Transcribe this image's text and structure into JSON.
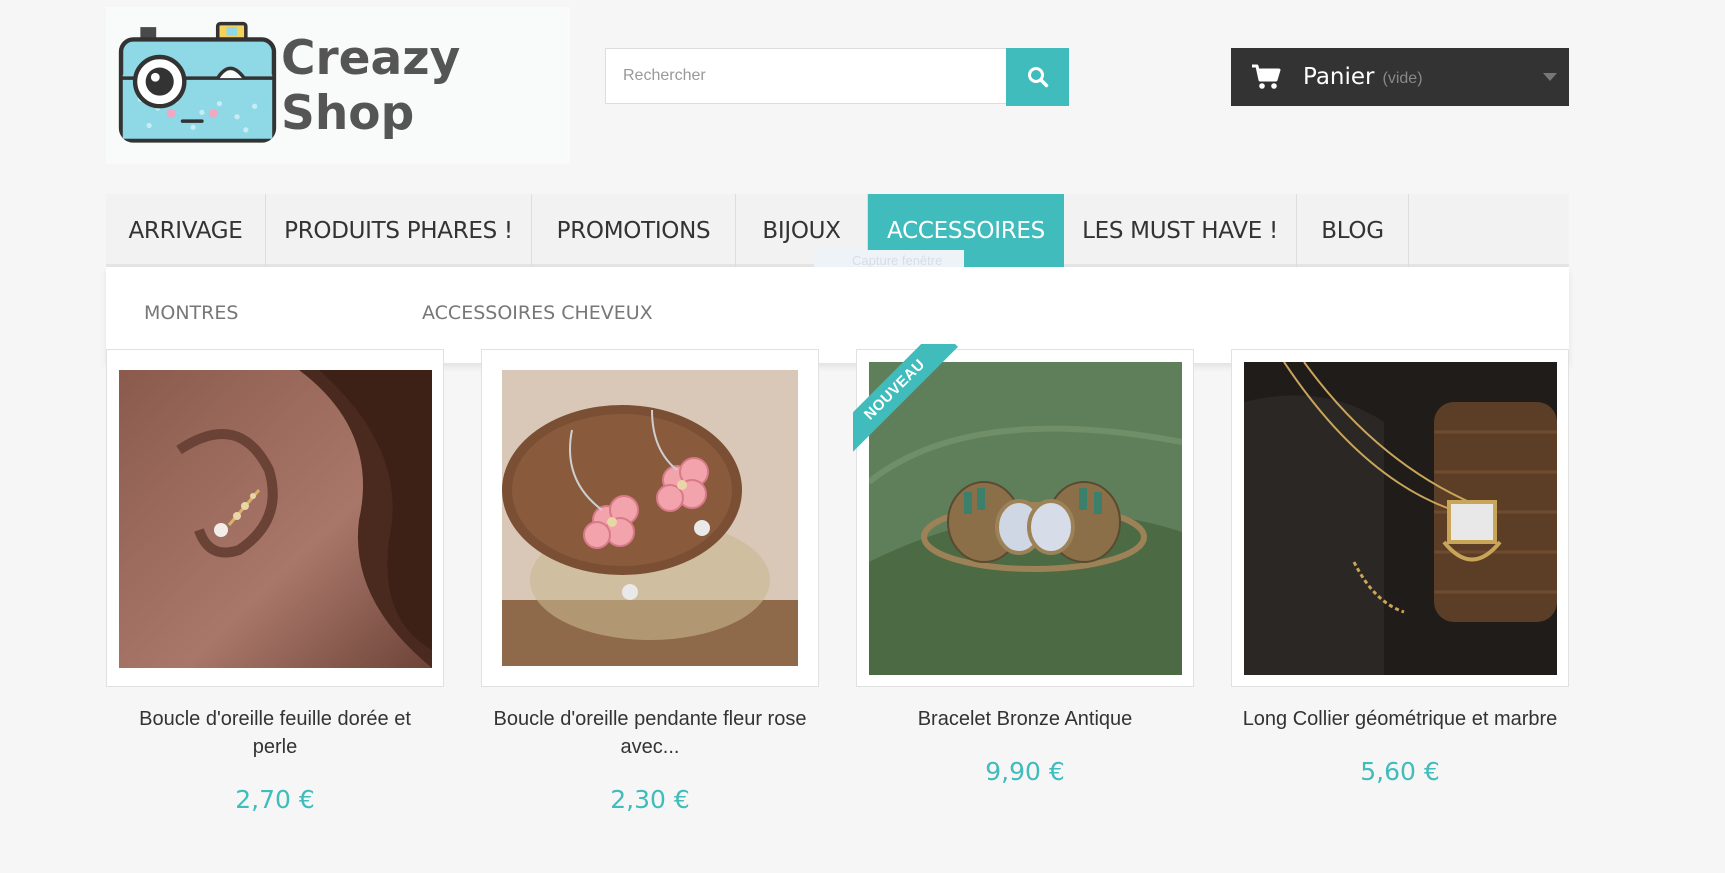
{
  "brand": {
    "name": "Creazy Shop"
  },
  "search": {
    "placeholder": "Rechercher"
  },
  "cart": {
    "label": "Panier",
    "status": "(vide)"
  },
  "menu": {
    "items": [
      {
        "label": "ARRIVAGE"
      },
      {
        "label": "PRODUITS PHARES !"
      },
      {
        "label": "PROMOTIONS"
      },
      {
        "label": "BIJOUX"
      },
      {
        "label": "ACCESSOIRES"
      },
      {
        "label": "LES MUST HAVE !"
      },
      {
        "label": "BLOG"
      }
    ],
    "active": "ACCESSOIRES"
  },
  "submenu": {
    "items": [
      {
        "label": "MONTRES"
      },
      {
        "label": "ACCESSOIRES CHEVEUX"
      }
    ]
  },
  "overlay_hint": "Capture fenêtre",
  "products": [
    {
      "name": "Boucle d'oreille feuille dorée et perle",
      "price": "2,70 €"
    },
    {
      "name": "Boucle d'oreille pendante fleur rose avec...",
      "price": "2,30 €"
    },
    {
      "name": "Bracelet Bronze Antique",
      "price": "9,90 €",
      "badge": "NOUVEAU"
    },
    {
      "name": "Long Collier géométrique et marbre",
      "price": "5,60 €"
    }
  ],
  "colors": {
    "accent": "#3fbcbb",
    "cart_bg": "#333333",
    "menu_bg": "#f2f2f2"
  },
  "icons": {
    "search": "search-icon",
    "cart": "cart-icon",
    "dropdown": "chevron-down-icon"
  }
}
